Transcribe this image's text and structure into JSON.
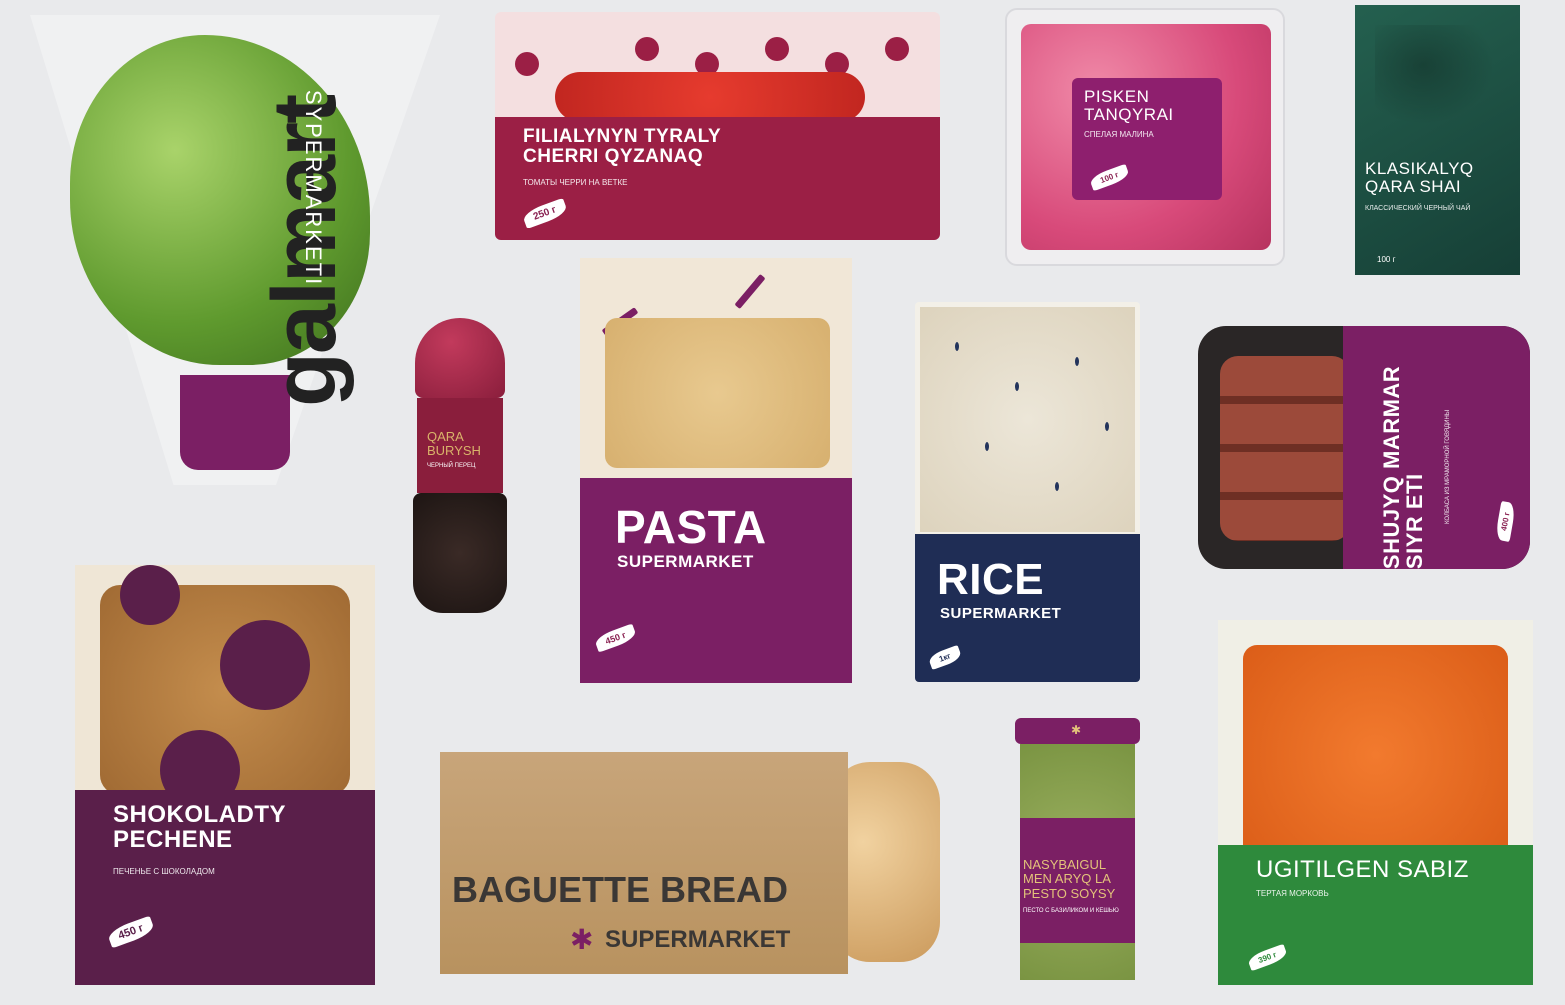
{
  "lettuce": {
    "brand": "galmart",
    "tagline": "SYPERMARKETI"
  },
  "tomatoes": {
    "title": "FILIALYNYN TYRALY CHERRI QYZANAQ",
    "subtitle": "ТОМАТЫ ЧЕРРИ НА ВЕТКЕ",
    "weight": "250 г"
  },
  "raspberries": {
    "title": "PISKEN TANQYRAI",
    "subtitle": "СПЕЛАЯ МАЛИНА",
    "weight": "100 г"
  },
  "tea": {
    "title": "KLASIKALYQ QARA SHAI",
    "subtitle": "КЛАССИЧЕСКИЙ ЧЕРНЫЙ ЧАЙ",
    "weight": "100 г"
  },
  "pepper": {
    "title": "QARA BURYSH",
    "subtitle": "ЧЕРНЫЙ ПЕРЕЦ"
  },
  "pasta": {
    "title": "PASTA",
    "brand": "SUPERMARKET",
    "weight": "450 г"
  },
  "rice": {
    "title": "RICE",
    "brand": "SUPERMARKET",
    "weight": "1кг"
  },
  "sausage": {
    "title": "SHUJYQ MARMAR SIYR ETI",
    "subtitle": "КОЛБАСА ИЗ МРАМОРНОЙ ГОВЯДИНЫ",
    "weight": "400 г"
  },
  "cookies": {
    "title": "SHOKOLADTY PECHENE",
    "subtitle": "ПЕЧЕНЬЕ С ШОКОЛАДОМ",
    "weight": "450 г"
  },
  "baguette": {
    "title": "BAGUETTE BREAD",
    "brand": "SUPERMARKET"
  },
  "pesto": {
    "title": "NASYBAIGUL MEN ARYQ LA PESTO SOYSY",
    "subtitle": "ПЕСТО С БАЗИЛИКОМ И КЕШЬЮ"
  },
  "carrots": {
    "title": "UGITILGEN SABIZ",
    "subtitle": "ТЕРТАЯ МОРКОВЬ",
    "weight": "390 г"
  },
  "colors": {
    "brand_purple": "#7b1f64",
    "wine": "#9b1f45",
    "navy": "#1f2d55",
    "teal": "#1d5147",
    "green": "#2e8a3c"
  }
}
